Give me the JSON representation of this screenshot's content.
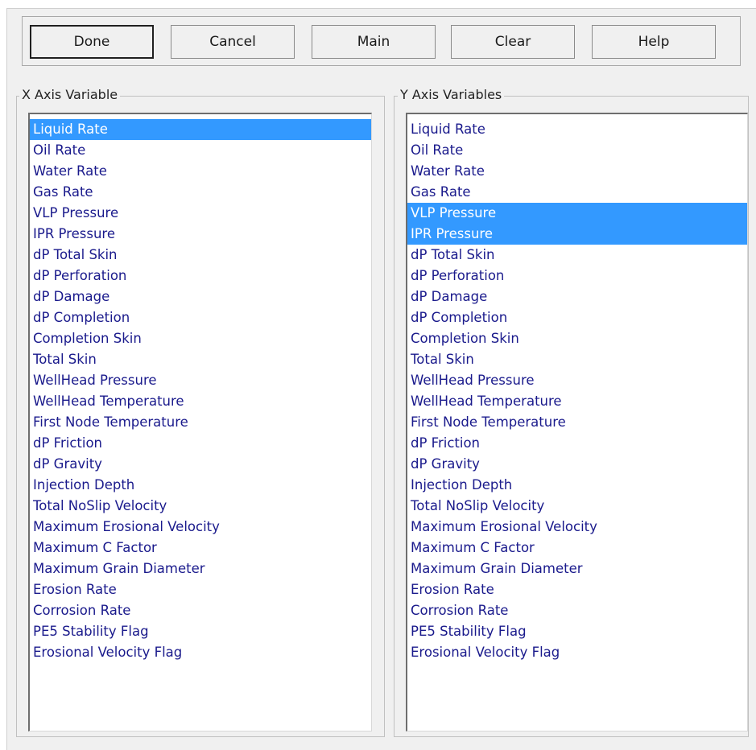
{
  "buttons": {
    "done": "Done",
    "cancel": "Cancel",
    "main": "Main",
    "clear": "Clear",
    "help": "Help"
  },
  "x_axis": {
    "title": "X Axis Variable",
    "selected": [
      "Liquid Rate"
    ],
    "items": [
      "Liquid Rate",
      "Oil Rate",
      "Water Rate",
      "Gas Rate",
      "VLP Pressure",
      "IPR Pressure",
      "dP Total Skin",
      "dP Perforation",
      "dP Damage",
      "dP Completion",
      "Completion Skin",
      "Total Skin",
      "WellHead Pressure",
      "WellHead Temperature",
      "First Node Temperature",
      "dP Friction",
      "dP Gravity",
      "Injection Depth",
      "Total NoSlip Velocity",
      "Maximum Erosional Velocity",
      "Maximum C Factor",
      "Maximum Grain Diameter",
      "Erosion Rate",
      "Corrosion Rate",
      "PE5 Stability Flag",
      "Erosional Velocity Flag"
    ]
  },
  "y_axis": {
    "title": "Y Axis Variables",
    "selected": [
      "VLP Pressure",
      "IPR Pressure"
    ],
    "items": [
      "Liquid Rate",
      "Oil Rate",
      "Water Rate",
      "Gas Rate",
      "VLP Pressure",
      "IPR Pressure",
      "dP Total Skin",
      "dP Perforation",
      "dP Damage",
      "dP Completion",
      "Completion Skin",
      "Total Skin",
      "WellHead Pressure",
      "WellHead Temperature",
      "First Node Temperature",
      "dP Friction",
      "dP Gravity",
      "Injection Depth",
      "Total NoSlip Velocity",
      "Maximum Erosional Velocity",
      "Maximum C Factor",
      "Maximum Grain Diameter",
      "Erosion Rate",
      "Corrosion Rate",
      "PE5 Stability Flag",
      "Erosional Velocity Flag"
    ]
  },
  "colors": {
    "selection": "#3399ff",
    "list_text": "#1a1a8c",
    "dialog_bg": "#f0f0f0"
  }
}
